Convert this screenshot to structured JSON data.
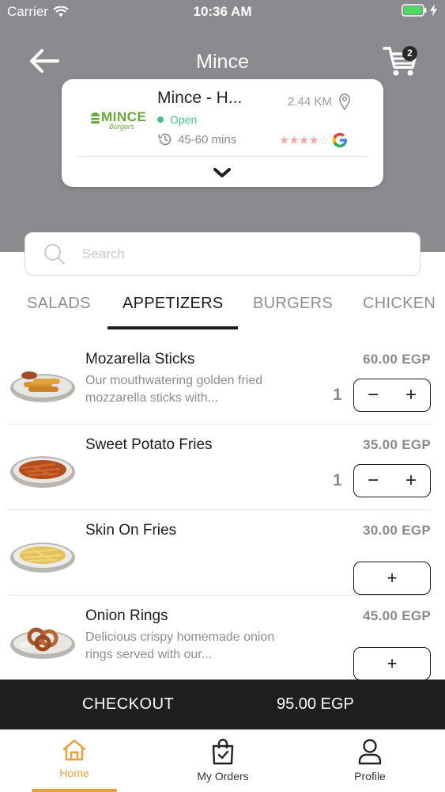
{
  "status_bar": {
    "carrier": "Carrier",
    "time": "10:36 AM"
  },
  "header": {
    "title": "Mince",
    "cart_count": "2"
  },
  "restaurant": {
    "logo_text": "MINCE",
    "logo_sub": "Burgers",
    "name": "Mince - H...",
    "status": "Open",
    "delivery_time": "45-60 mins",
    "distance": "2.44 KM",
    "rating_stars": 4,
    "rating_source_logo": "G"
  },
  "search": {
    "placeholder": "Search"
  },
  "tabs": [
    {
      "label": "SALADS"
    },
    {
      "label": "APPETIZERS"
    },
    {
      "label": "BURGERS"
    },
    {
      "label": "CHICKEN"
    }
  ],
  "active_tab": "APPETIZERS",
  "items": [
    {
      "name": "Mozarella Sticks",
      "desc": "Our mouthwatering golden fried mozzarella sticks with...",
      "price": "60.00 EGP",
      "qty": "1"
    },
    {
      "name": "Sweet Potato Fries",
      "desc": "",
      "price": "35.00 EGP",
      "qty": "1"
    },
    {
      "name": "Skin On Fries",
      "desc": "",
      "price": "30.00 EGP",
      "qty": ""
    },
    {
      "name": "Onion Rings",
      "desc": "Delicious crispy homemade onion rings served with our...",
      "price": "45.00 EGP",
      "qty": ""
    }
  ],
  "checkout": {
    "label": "CHECKOUT",
    "total": "95.00 EGP"
  },
  "nav": [
    {
      "label": "Home",
      "icon": "home-icon"
    },
    {
      "label": "My Orders",
      "icon": "shopping-bag-icon"
    },
    {
      "label": "Profile",
      "icon": "user-icon"
    }
  ],
  "colors": {
    "header_bg": "#8b8a8f",
    "accent": "#e8a13a",
    "open_green": "#4cc08b",
    "checkout_bg": "#1f1f1f"
  }
}
